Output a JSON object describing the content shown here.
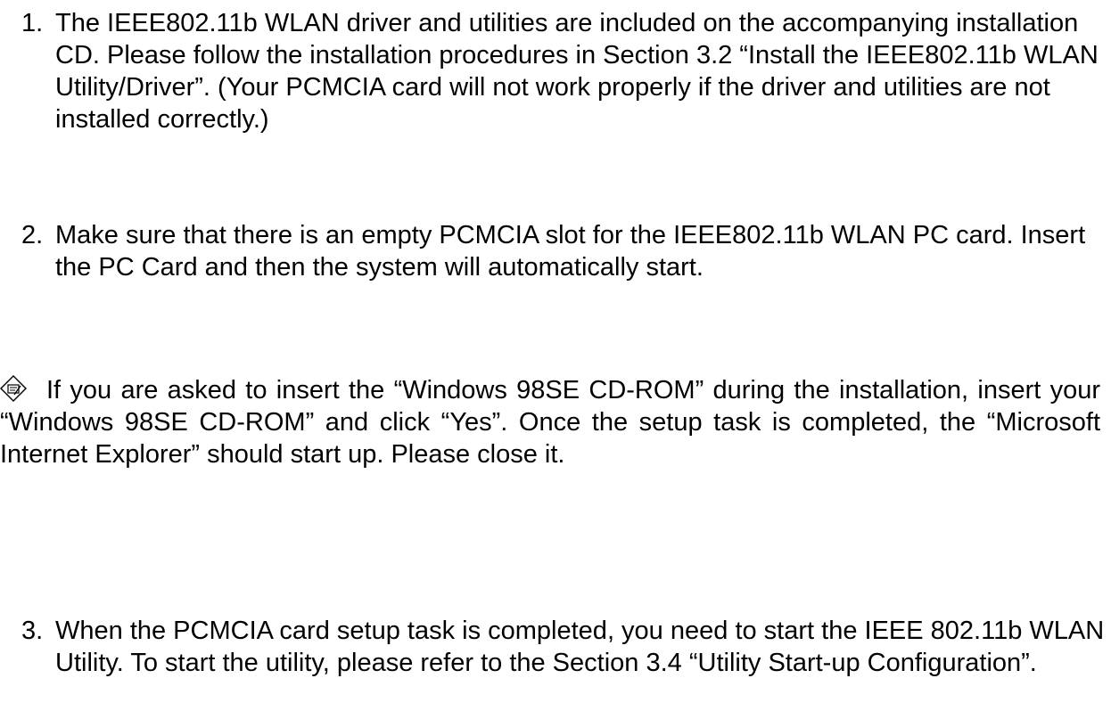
{
  "steps": [
    {
      "number": "1.",
      "text": "The IEEE802.11b WLAN driver and utilities are included on the accompanying installation CD.  Please follow the installation procedures in Section 3.2 “Install the IEEE802.11b WLAN Utility/Driver”. (Your PCMCIA card will not work properly if the driver and utilities are not installed correctly.)"
    },
    {
      "number": "2.",
      "text": "Make sure that there is an empty PCMCIA slot for the IEEE802.11b WLAN PC card. Insert the PC Card and then the system will automatically start."
    },
    {
      "number": "3.",
      "text": "When the PCMCIA card setup task is completed, you need to start the IEEE 802.11b WLAN Utility. To start the utility, please refer to the Section 3.4 “Utility Start-up Configuration”."
    }
  ],
  "note": {
    "icon": "note-icon",
    "text": "If you are asked to insert the “Windows 98SE CD-ROM” during the installation, insert your “Windows 98SE CD-ROM” and click “Yes”. Once the setup task is completed, the  “Microsoft Internet Explorer” should start up. Please close it."
  }
}
